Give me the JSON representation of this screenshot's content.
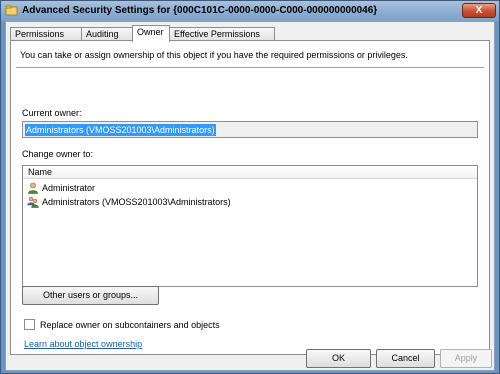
{
  "window": {
    "title": "Advanced Security Settings for {000C101C-0000-0000-C000-000000000046}",
    "close_label": "X"
  },
  "tabs": [
    {
      "label": "Permissions",
      "active": false
    },
    {
      "label": "Auditing",
      "active": false
    },
    {
      "label": "Owner",
      "active": true
    },
    {
      "label": "Effective Permissions",
      "active": false
    }
  ],
  "owner_tab": {
    "info_text": "You can take or assign ownership of this object if you have the required permissions or privileges.",
    "current_owner_label": "Current owner:",
    "current_owner_value": "Administrators (VMOSS201003\\Administrators)",
    "change_owner_label": "Change owner to:",
    "list_header": "Name",
    "list_items": [
      {
        "name": "Administrator",
        "icon": "user-icon"
      },
      {
        "name": "Administrators (VMOSS201003\\Administrators)",
        "icon": "group-icon"
      }
    ],
    "other_users_button": "Other users or groups...",
    "replace_checkbox_label": "Replace owner on subcontainers and objects",
    "replace_checked": false,
    "learn_link": "Learn about object ownership"
  },
  "footer": {
    "ok": "OK",
    "cancel": "Cancel",
    "apply": "Apply"
  },
  "colors": {
    "title_gradient": "#8eaed2",
    "selection": "#3399ff",
    "link": "#0066cc"
  }
}
